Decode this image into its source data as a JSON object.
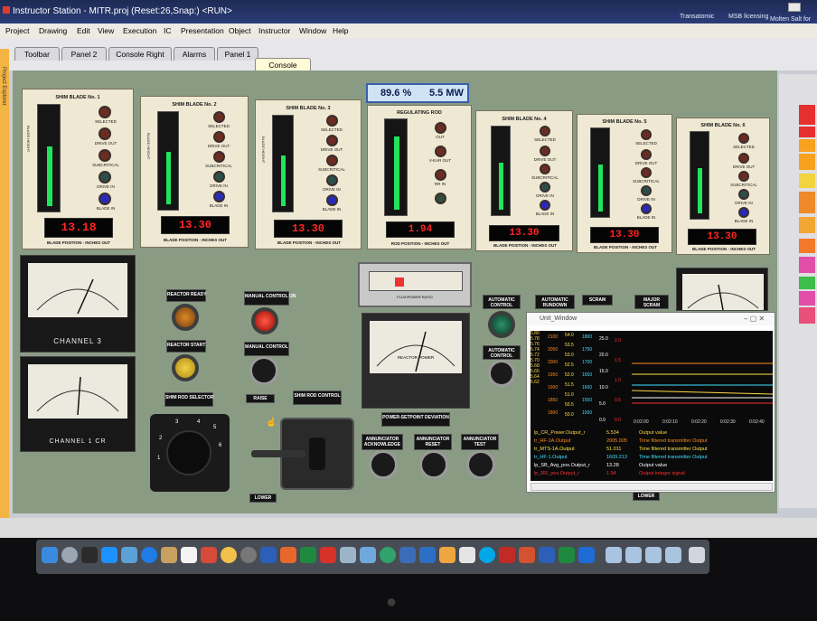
{
  "window": {
    "title": "Instructor Station - MITR.proj (Reset:26,Snap:) <RUN>"
  },
  "menubar": {
    "items": [
      "Project",
      "Drawing",
      "Edit",
      "View",
      "Execution",
      "IC",
      "Presentation",
      "Object",
      "Instructor",
      "Window",
      "Help"
    ]
  },
  "tabs": {
    "items": [
      "Toolbar",
      "Panel 2",
      "Console Right",
      "Alarms",
      "Panel 1",
      "Console"
    ],
    "active": "Console"
  },
  "desktop_icons": [
    "Transatomic",
    "MSB licensing",
    "Molten Salt for"
  ],
  "left_strip_label": "Project Explorer",
  "power_display": {
    "percent": "89.6 %",
    "mw": "5.5 MW"
  },
  "blades": [
    {
      "title": "SHIM BLADE No. 1",
      "value": "13.18",
      "caption": "BLADE POSITION - INCHES OUT",
      "level": 0.62
    },
    {
      "title": "SHIM BLADE No. 2",
      "value": "13.30",
      "caption": "BLADE POSITION - INCHES OUT",
      "level": 0.6
    },
    {
      "title": "SHIM BLADE No. 3",
      "value": "13.30",
      "caption": "BLADE POSITION - INCHES OUT",
      "level": 0.6
    },
    {
      "title": "REGULATING ROD",
      "value": "1.94",
      "caption": "ROD POSITION - INCHES OUT",
      "level": 0.86
    },
    {
      "title": "SHIM BLADE No. 4",
      "value": "13.30",
      "caption": "BLADE POSITION - INCHES OUT",
      "level": 0.6
    },
    {
      "title": "SHIM BLADE No. 5",
      "value": "13.30",
      "caption": "BLADE POSITION - INCHES OUT",
      "level": 0.6
    },
    {
      "title": "SHIM BLADE No. 6",
      "value": "13.30",
      "caption": "BLADE POSITION - INCHES OUT",
      "level": 0.6
    }
  ],
  "blade_lamps": [
    "SELECTED",
    "DRIVE OUT",
    "SUBCRITICAL",
    "DRIVE IN",
    "BLADE IN"
  ],
  "reg_lamps": [
    "OUT",
    "V-EAR OUT",
    "RR IN"
  ],
  "blade_side_label": "BLADE HEIGHT",
  "channels": {
    "ch3": "CHANNEL 3",
    "ch1": "CHANNEL 1 CR"
  },
  "buttons": {
    "reactor_ready": "REACTOR READY",
    "manual_control_on": "MANUAL CONTROL ON",
    "reactor_start": "REACTOR START",
    "manual_control": "MANUAL CONTROL",
    "shim_rod_selector": "SHIM ROD SELECTOR",
    "raise": "RAISE",
    "shim_rod_control": "SHIM ROD CONTROL",
    "lower": "LOWER",
    "lower2": "LOWER",
    "automatic_control": "AUTOMATIC CONTROL",
    "automatic_control2": "AUTOMATIC CONTROL",
    "automatic_rundown": "AUTOMATIC RUNDOWN",
    "scram": "SCRAM",
    "major_scram": "MAJOR SCRAM",
    "annunciator_acknowledge": "ANNUNCIATOR ACKNOWLEDGE",
    "annunciator_reset": "ANNUNCIATOR RESET",
    "annunciator_test": "ANNUNCIATOR TEST",
    "power_setpoint_deviation": "POWER-SETPOINT DEVIATION"
  },
  "selector_positions": [
    "1",
    "2",
    "3",
    "4",
    "5",
    "6"
  ],
  "reactor_power_meter": "REACTOR POWER",
  "flux_meter": "FLUX/POWER RATIO",
  "trend": {
    "title": "Unit_Window",
    "axis_cols": [
      [
        "5.80",
        "5.78",
        "5.76",
        "5.74",
        "5.72",
        "5.70",
        "5.68",
        "5.66",
        "5.64",
        "5.62"
      ],
      [
        "2100",
        "2050",
        "2000",
        "1950",
        "1900",
        "1850",
        "1800"
      ],
      [
        "54.0",
        "53.5",
        "53.0",
        "52.5",
        "52.0",
        "51.5",
        "51.0",
        "50.5",
        "50.0"
      ],
      [
        "1800",
        "1750",
        "1700",
        "1650",
        "1600",
        "1550",
        "1500"
      ],
      [
        "25.0",
        "20.0",
        "15.0",
        "10.0",
        "5.0",
        "0.0"
      ],
      [
        "2.0",
        "1.5",
        "1.0",
        "0.5",
        "0.0"
      ]
    ],
    "time_ticks": [
      "0:02:00",
      "0:02:10",
      "0:02:20",
      "0:02:30",
      "0:02:40"
    ],
    "rows": [
      {
        "name": "lp_CR_Power.Output_r",
        "value": "5.534",
        "desc": "Output value",
        "color": "#ffd84a"
      },
      {
        "name": "tr_HF-1A.Output",
        "value": "2005.005",
        "desc": "Time filtered transmitter Output",
        "color": "#ff8c1a"
      },
      {
        "name": "tr_MTS-1A.Output",
        "value": "51.011",
        "desc": "Time filtered transmitter Output",
        "color": "#ffe840"
      },
      {
        "name": "tr_HF-1.Output",
        "value": "1609.213",
        "desc": "Time filtered transmitter Output",
        "color": "#3ee0ff"
      },
      {
        "name": "lp_SB_Avg_pos.Output_r",
        "value": "13.28",
        "desc": "Output value",
        "color": "#ffffff"
      },
      {
        "name": "lp_RR_pos.Output_r",
        "value": "1.94",
        "desc": "Output integer signal",
        "color": "#ff3030"
      }
    ]
  }
}
